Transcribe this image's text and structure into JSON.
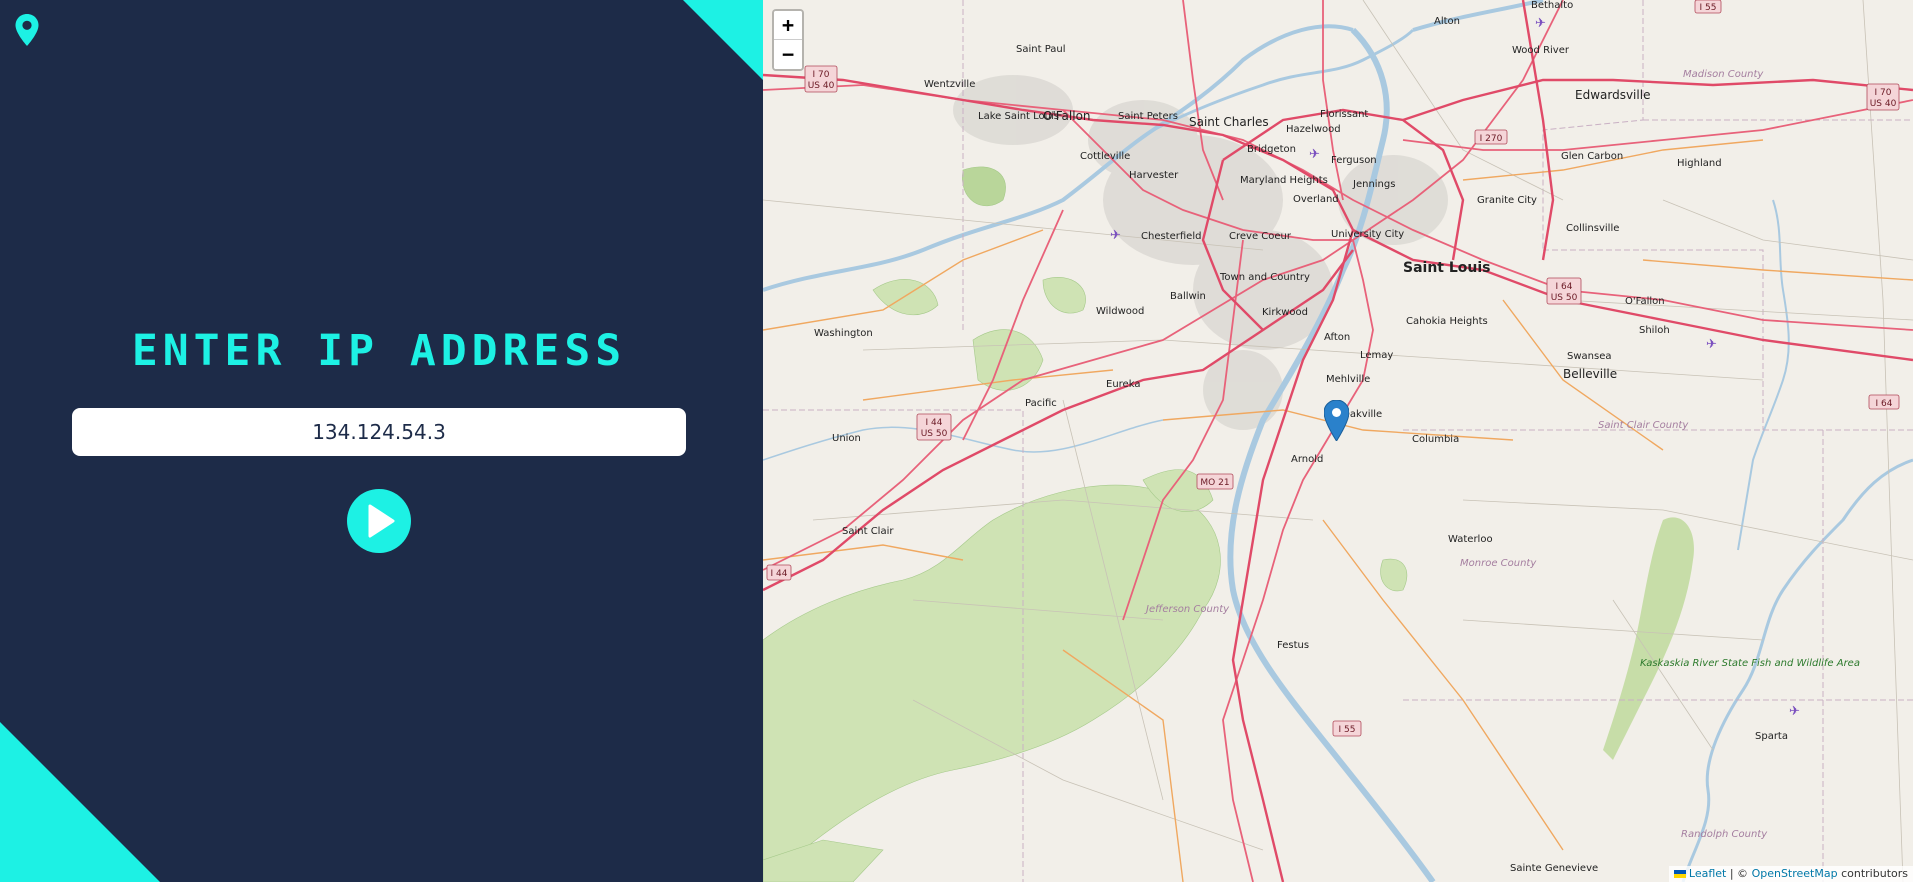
{
  "app": {
    "heading": "ENTER IP ADDRESS",
    "logo_icon": "location-pin-icon",
    "accent_color": "#1df1e4",
    "panel_color": "#1d2b48"
  },
  "search": {
    "value": "134.124.54.3",
    "submit_icon": "play-icon"
  },
  "map": {
    "zoom_in_label": "+",
    "zoom_out_label": "−",
    "marker_icon": "map-marker-icon",
    "attribution": {
      "leaflet": "Leaflet",
      "separator": "| ©",
      "osm": "OpenStreetMap",
      "suffix": "contributors"
    },
    "places": {
      "saint_louis": "Saint Louis",
      "saint_charles": "Saint Charles",
      "ofallon_mo": "O'Fallon",
      "edwardsville": "Edwardsville",
      "belleville": "Belleville",
      "alton": "Alton",
      "bethalto": "Bethalto",
      "wood_river": "Wood River",
      "saint_paul": "Saint Paul",
      "wentzville": "Wentzville",
      "lake_saint_louis": "Lake Saint Louis",
      "saint_peters": "Saint Peters",
      "florissant": "Florissant",
      "hazelwood": "Hazelwood",
      "bridgeton": "Bridgeton",
      "ferguson": "Ferguson",
      "cottleville": "Cottleville",
      "harvester": "Harvester",
      "maryland_heights": "Maryland Heights",
      "overland": "Overland",
      "jennings": "Jennings",
      "granite_city": "Granite City",
      "glen_carbon": "Glen Carbon",
      "highland": "Highland",
      "collinsville": "Collinsville",
      "chesterfield": "Chesterfield",
      "creve_coeur": "Creve Coeur",
      "university_city": "University City",
      "town_and_country": "Town and Country",
      "ballwin": "Ballwin",
      "wildwood": "Wildwood",
      "kirkwood": "Kirkwood",
      "cahokia_heights": "Cahokia Heights",
      "ofallon_il": "O'Fallon",
      "shiloh": "Shiloh",
      "swansea": "Swansea",
      "washington": "Washington",
      "afton": "Afton",
      "lemay": "Lemay",
      "eureka": "Eureka",
      "pacific": "Pacific",
      "mehlville": "Mehlville",
      "oakville": "Oakville",
      "columbia": "Columbia",
      "union": "Union",
      "arnold": "Arnold",
      "saint_clair": "Saint Clair",
      "waterloo": "Waterloo",
      "festus": "Festus",
      "sparta": "Sparta",
      "sainte_genevieve": "Sainte Genevieve"
    },
    "counties": {
      "madison": "Madison County",
      "saint_clair": "Saint Clair County",
      "monroe": "Monroe County",
      "jefferson": "Jefferson County",
      "randolph": "Randolph County"
    },
    "parks": {
      "kaskaskia": "Kaskaskia River State Fish and Wildlife Area"
    },
    "shields": {
      "i70_us40_w": [
        "I 70",
        "US 40"
      ],
      "i70_us40_e": [
        "I 70",
        "US 40"
      ],
      "i270": [
        "I 270"
      ],
      "i55_n": [
        "I 55"
      ],
      "i64_us50": [
        "I 64",
        "US 50"
      ],
      "i64_e": [
        "I 64"
      ],
      "i44_us50": [
        "I 44",
        "US 50"
      ],
      "mo21": [
        "MO 21"
      ],
      "i44_w": [
        "I 44"
      ],
      "i55_s": [
        "I 55"
      ]
    }
  }
}
